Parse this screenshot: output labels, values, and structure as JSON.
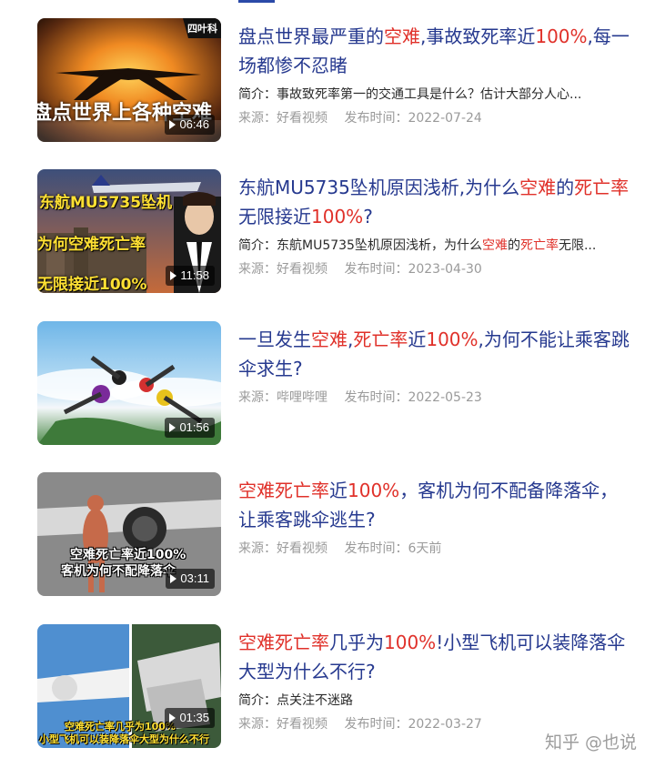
{
  "colors": {
    "title": "#26398f",
    "highlight": "#e0312a",
    "meta": "#9a9a9a"
  },
  "videos": [
    {
      "title_parts": [
        {
          "text": "盘点世界最严重的",
          "hl": false
        },
        {
          "text": "空难",
          "hl": true
        },
        {
          "text": ",事故致死率近",
          "hl": false
        },
        {
          "text": "100%",
          "hl": true
        },
        {
          "text": ",每一场都惨不忍睹",
          "hl": false
        }
      ],
      "summary_parts": [
        {
          "text": "简介：事故致死率第一的交通工具是什么？估计大部分人心...",
          "hl": false
        }
      ],
      "source": "来源：好看视频",
      "date": "发布时间：2022-07-24",
      "duration": "06:46",
      "thumb_caption": "盘点世界上各种空难",
      "thumb_badge": "四叶科"
    },
    {
      "title_parts": [
        {
          "text": "东航MU5735坠机原因浅析,为什么",
          "hl": false
        },
        {
          "text": "空难",
          "hl": true
        },
        {
          "text": "的",
          "hl": false
        },
        {
          "text": "死亡率",
          "hl": true
        },
        {
          "text": "无限接近",
          "hl": false
        },
        {
          "text": "100%",
          "hl": true
        },
        {
          "text": "?",
          "hl": false
        }
      ],
      "summary_parts": [
        {
          "text": "简介：东航MU5735坠机原因浅析，为什么",
          "hl": false
        },
        {
          "text": "空难",
          "hl": true
        },
        {
          "text": "的",
          "hl": false
        },
        {
          "text": "死亡率",
          "hl": true
        },
        {
          "text": "无限...",
          "hl": false
        }
      ],
      "source": "来源：好看视频",
      "date": "发布时间：2023-04-30",
      "duration": "11:58",
      "thumb_caption_lines": [
        "东航MU5735坠机",
        "为何空难死亡率",
        "无限接近100%"
      ]
    },
    {
      "title_parts": [
        {
          "text": "一旦发生",
          "hl": false
        },
        {
          "text": "空难",
          "hl": true
        },
        {
          "text": ",",
          "hl": false
        },
        {
          "text": "死亡率",
          "hl": true
        },
        {
          "text": "近",
          "hl": false
        },
        {
          "text": "100%",
          "hl": true
        },
        {
          "text": ",为何不能让乘客跳伞求生?",
          "hl": false
        }
      ],
      "summary_parts": [],
      "source": "来源：哔哩哔哩",
      "date": "发布时间：2022-05-23",
      "duration": "01:56"
    },
    {
      "title_parts": [
        {
          "text": "空难死亡率",
          "hl": true
        },
        {
          "text": "近",
          "hl": false
        },
        {
          "text": "100%",
          "hl": true
        },
        {
          "text": "，客机为何不配备降落伞，让乘客跳伞逃生?",
          "hl": false
        }
      ],
      "summary_parts": [],
      "source": "来源：好看视频",
      "date": "发布时间：6天前",
      "duration": "03:11",
      "thumb_caption_lines": [
        "空难死亡率近100%",
        "客机为何不配降落伞"
      ]
    },
    {
      "title_parts": [
        {
          "text": "空难死亡率",
          "hl": true
        },
        {
          "text": "几乎为",
          "hl": false
        },
        {
          "text": "100%",
          "hl": true
        },
        {
          "text": "!小型飞机可以装降落伞大型为什么不行?",
          "hl": false
        }
      ],
      "summary_parts": [
        {
          "text": "简介：点关注不迷路",
          "hl": false
        }
      ],
      "source": "来源：好看视频",
      "date": "发布时间：2022-03-27",
      "duration": "01:35",
      "thumb_caption_lines": [
        "空难死亡率几乎为100%",
        "小型飞机可以装降落伞大型为什么不行"
      ]
    }
  ],
  "watermark": "知乎 @也说"
}
